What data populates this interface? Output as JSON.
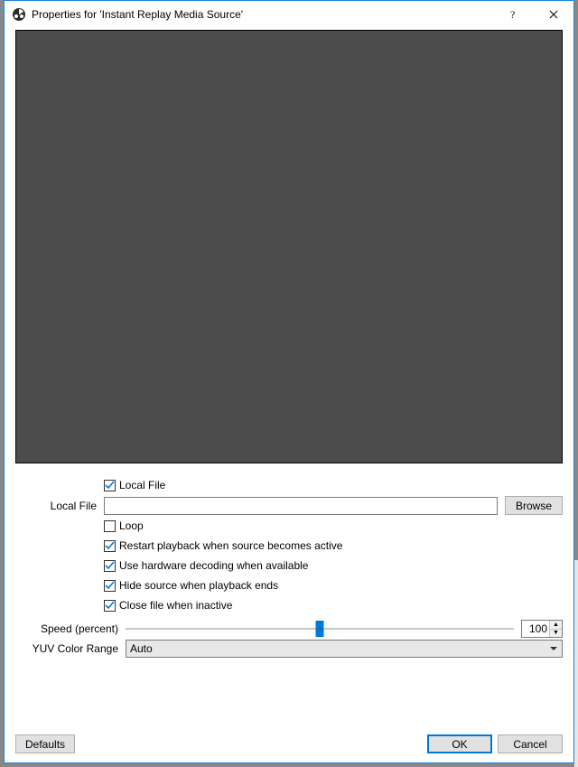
{
  "window": {
    "title": "Properties for 'Instant Replay Media Source'"
  },
  "form": {
    "local_file_checkbox": {
      "label": "Local File",
      "checked": true
    },
    "local_file_row": {
      "label": "Local File",
      "value": "",
      "browse": "Browse"
    },
    "loop": {
      "label": "Loop",
      "checked": false
    },
    "restart_playback": {
      "label": "Restart playback when source becomes active",
      "checked": true
    },
    "hw_decoding": {
      "label": "Use hardware decoding when available",
      "checked": true
    },
    "hide_source": {
      "label": "Hide source when playback ends",
      "checked": true
    },
    "close_inactive": {
      "label": "Close file when inactive",
      "checked": true
    },
    "speed": {
      "label": "Speed (percent)",
      "value": "100"
    },
    "yuv": {
      "label": "YUV Color Range",
      "value": "Auto"
    }
  },
  "footer": {
    "defaults": "Defaults",
    "ok": "OK",
    "cancel": "Cancel"
  }
}
